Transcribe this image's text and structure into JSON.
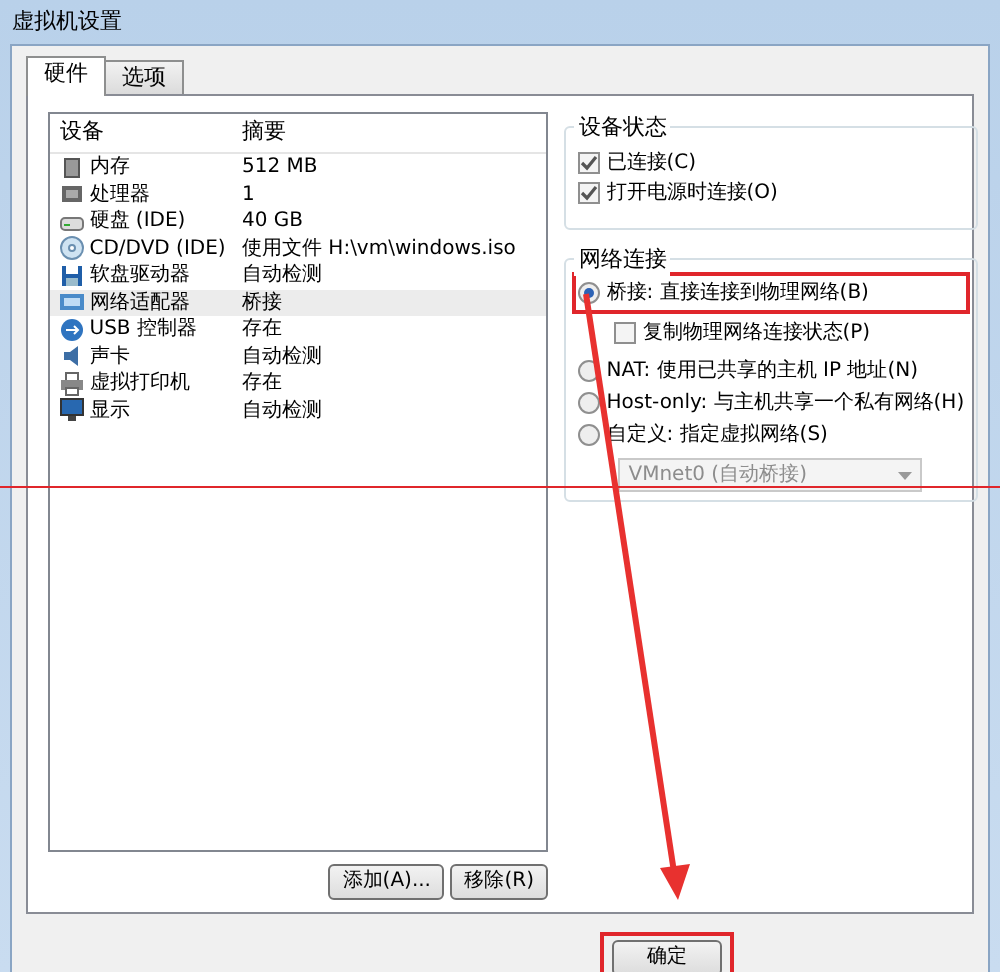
{
  "window": {
    "title": "虚拟机设置"
  },
  "tabs": [
    {
      "label": "硬件",
      "selected": true
    },
    {
      "label": "选项",
      "selected": false
    }
  ],
  "device_list": {
    "columns": [
      "设备",
      "摘要"
    ],
    "rows": [
      {
        "kind": "memory",
        "device": "内存",
        "summary": "512 MB",
        "selected": false
      },
      {
        "kind": "processor",
        "device": "处理器",
        "summary": "1",
        "selected": false
      },
      {
        "kind": "disk",
        "device": "硬盘 (IDE)",
        "summary": "40 GB",
        "selected": false
      },
      {
        "kind": "cd",
        "device": "CD/DVD (IDE)",
        "summary": "使用文件 H:\\vm\\windows.iso",
        "selected": false
      },
      {
        "kind": "floppy",
        "device": "软盘驱动器",
        "summary": "自动检测",
        "selected": false
      },
      {
        "kind": "network",
        "device": "网络适配器",
        "summary": "桥接",
        "selected": true
      },
      {
        "kind": "usb",
        "device": "USB 控制器",
        "summary": "存在",
        "selected": false
      },
      {
        "kind": "sound",
        "device": "声卡",
        "summary": "自动检测",
        "selected": false
      },
      {
        "kind": "printer",
        "device": "虚拟打印机",
        "summary": "存在",
        "selected": false
      },
      {
        "kind": "display",
        "device": "显示",
        "summary": "自动检测",
        "selected": false
      }
    ]
  },
  "list_buttons": [
    "添加(A)...",
    "移除(R)"
  ],
  "device_status": {
    "title": "设备状态",
    "options": [
      {
        "label": "已连接(C)",
        "checked": true
      },
      {
        "label": "打开电源时连接(O)",
        "checked": true
      }
    ]
  },
  "network": {
    "title": "网络连接",
    "options": [
      {
        "kind": "radio",
        "label": "桥接: 直接连接到物理网络(B)",
        "selected": true,
        "highlighted": true
      },
      {
        "kind": "checkbox",
        "label": "复制物理网络连接状态(P)",
        "checked": false
      },
      {
        "kind": "radio",
        "label": "NAT: 使用已共享的主机 IP 地址(N)",
        "selected": false,
        "highlighted": false
      },
      {
        "kind": "radio",
        "label": "Host-only: 与主机共享一个私有网络(H)",
        "selected": false,
        "highlighted": false
      },
      {
        "kind": "radio",
        "label": "自定义: 指定虚拟网络(S)",
        "selected": false,
        "highlighted": false
      }
    ],
    "dropdown": {
      "value": "VMnet0 (自动桥接)",
      "disabled": true
    }
  },
  "footer_buttons": [
    {
      "label": "确定",
      "highlighted": true
    }
  ]
}
